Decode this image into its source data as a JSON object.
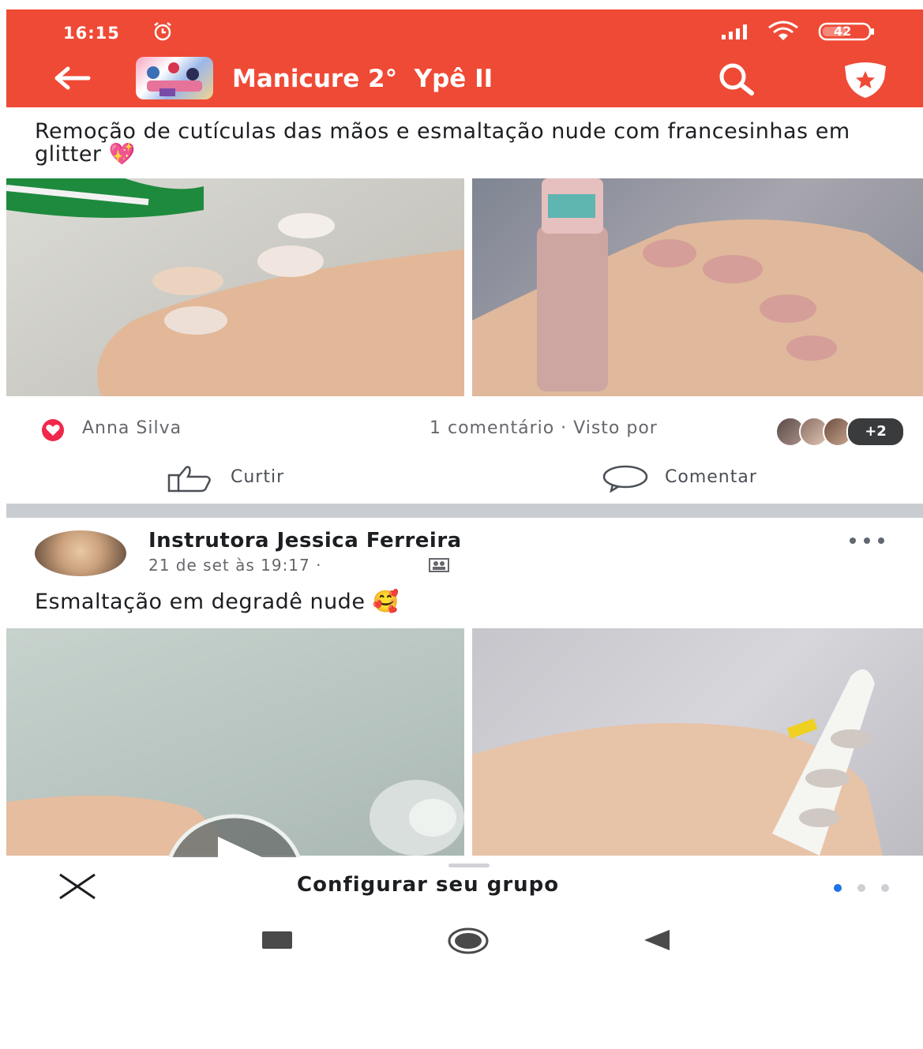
{
  "status_bar": {
    "time": "16:15",
    "battery": "42"
  },
  "header": {
    "group_title": "Manicure 2°  Ypê II"
  },
  "post1": {
    "text": "Remoção de cutículas das mãos e esmaltação nude com francesinhas em glitter 💖",
    "reactor": "Anna Silva",
    "comments_seen": "1 comentário · Visto por",
    "seen_more": "+2",
    "like_label": "Curtir",
    "comment_label": "Comentar"
  },
  "post2": {
    "author": "Instrutora Jessica Ferreira",
    "time": "21 de set às 19:17 ·",
    "text": "Esmaltação em degradê nude 🥰"
  },
  "bottom_sheet": {
    "title": "Configurar seu grupo"
  },
  "icons": [
    "alarm-icon",
    "signal-icon",
    "wifi-icon",
    "battery-icon",
    "back-arrow-icon",
    "search-icon",
    "shield-star-icon",
    "heart-reaction-icon",
    "thumbs-up-icon",
    "comment-bubble-icon",
    "more-dots-icon",
    "group-icon",
    "play-icon",
    "close-icon",
    "recent-apps-icon",
    "home-icon",
    "back-icon"
  ],
  "colors": {
    "header": "#ef4a36",
    "accent": "#1b74e4",
    "heart": "#f0284a"
  }
}
